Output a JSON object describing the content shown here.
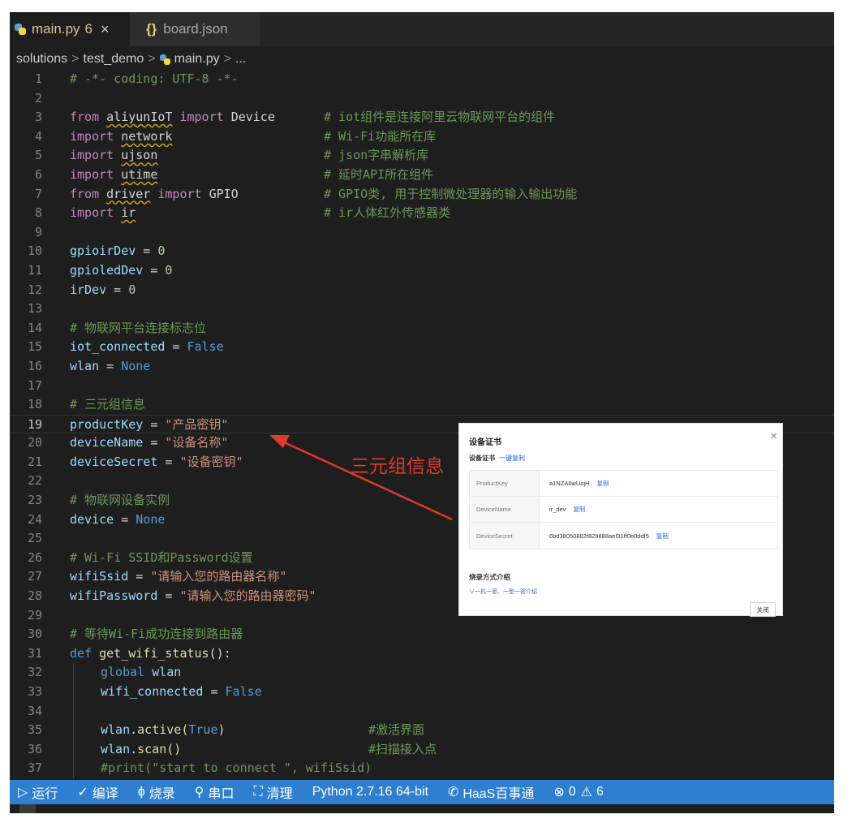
{
  "tabs": [
    {
      "title": "main.py",
      "problems": "6",
      "close": "×",
      "icon": "python-file-icon"
    },
    {
      "braces": "{}",
      "title": "board.json",
      "icon": "json-file-icon"
    }
  ],
  "breadcrumb": {
    "parts": [
      "solutions",
      "test_demo",
      "main.py",
      "..."
    ],
    "sep": ">"
  },
  "gutter": [
    "1",
    "2",
    "3",
    "4",
    "5",
    "6",
    "7",
    "8",
    "9",
    "10",
    "11",
    "12",
    "13",
    "14",
    "15",
    "16",
    "17",
    "18",
    "19",
    "20",
    "21",
    "22",
    "23",
    "24",
    "25",
    "26",
    "27",
    "28",
    "29",
    "30",
    "31",
    "32",
    "33",
    "34",
    "35",
    "36",
    "37"
  ],
  "code": {
    "l1": "# -*- coding: UTF-8 -*-",
    "l3_kw1": "from",
    "l3_mod": "aliyunIoT",
    "l3_kw2": "import",
    "l3_name": "Device",
    "l3_cmt": "# iot组件是连接阿里云物联网平台的组件",
    "l4_kw": "import",
    "l4_mod": "network",
    "l4_cmt": "# Wi-Fi功能所在库",
    "l5_kw": "import",
    "l5_mod": "ujson",
    "l5_cmt": "# json字串解析库",
    "l6_kw": "import",
    "l6_mod": "utime",
    "l6_cmt": "# 延时API所在组件",
    "l7_kw1": "from",
    "l7_mod": "driver",
    "l7_kw2": "import",
    "l7_name": "GPIO",
    "l7_cmt": "# GPIO类, 用于控制微处理器的输入输出功能",
    "l8_kw": "import",
    "l8_mod": "ir",
    "l8_cmt": "# ir人体红外传感器类",
    "l10_id": "gpioirDev",
    "l10_op": " = ",
    "l10_val": "0",
    "l11_id": "gpioledDev",
    "l11_op": " = ",
    "l11_val": "0",
    "l12_id": "irDev",
    "l12_op": " = ",
    "l12_val": "0",
    "l14": "# 物联网平台连接标志位",
    "l15_id": "iot_connected",
    "l15_op": " = ",
    "l15_val": "False",
    "l16_id": "wlan",
    "l16_op": " = ",
    "l16_val": "None",
    "l18": "# 三元组信息",
    "l19_id": "productKey",
    "l19_op": " = ",
    "l19_val": "\"产品密钥\"",
    "l20_id": "deviceName",
    "l20_op": " = ",
    "l20_val": "\"设备名称\"",
    "l21_id": "deviceSecret",
    "l21_op": " = ",
    "l21_val": "\"设备密钥\"",
    "l23": "# 物联网设备实例",
    "l24_id": "device",
    "l24_op": " = ",
    "l24_val": "None",
    "l26": "# Wi-Fi SSID和Password设置",
    "l27_id": "wifiSsid",
    "l27_op": " = ",
    "l27_val": "\"请输入您的路由器名称\"",
    "l28_id": "wifiPassword",
    "l28_op": " = ",
    "l28_val": "\"请输入您的路由器密码\"",
    "l30": "# 等待Wi-Fi成功连接到路由器",
    "l31_kw": "def",
    "l31_fn": "get_wifi_status",
    "l31_rest": "():",
    "l32_kw": "global",
    "l32_id": "wlan",
    "l33_id": "wifi_connected",
    "l33_op": " = ",
    "l33_val": "False",
    "l35_id": "wlan",
    "l35_fn": ".active(",
    "l35_val": "True",
    "l35_close": ")",
    "l35_cmt": "#激活界面",
    "l36_id": "wlan",
    "l36_fn": ".scan()",
    "l36_cmt": "#扫描接入点",
    "l37": "#print(\"start to connect \", wifiSsid)"
  },
  "dialog": {
    "title": "设备证书",
    "close": "×",
    "subtitle": "设备证书",
    "copy_all": "一键复制",
    "rows": [
      {
        "key": "ProductKey",
        "value": "a1NZA6wUojH",
        "copy": "复制"
      },
      {
        "key": "DeviceName",
        "value": "ir_dev",
        "copy": "复制"
      },
      {
        "key": "DeviceSecret",
        "value": "6bd38050882f829888aef31ff0e0ddf5",
        "copy": "复制"
      }
    ],
    "burn_title": "烧录方式介绍",
    "burn_link": "一机一密、一型一密介绍",
    "close_button": "关闭"
  },
  "annotation": {
    "label": "三元组信息",
    "color": "#e0392b"
  },
  "statusbar": {
    "run": "运行",
    "compile": "编译",
    "burn": "烧录",
    "serial": "串口",
    "clean": "清理",
    "python": "Python 2.7.16 64-bit",
    "haas": "HaaS百事通",
    "errors": "0",
    "warnings": "6",
    "bg_color": "#2f7fd1"
  }
}
